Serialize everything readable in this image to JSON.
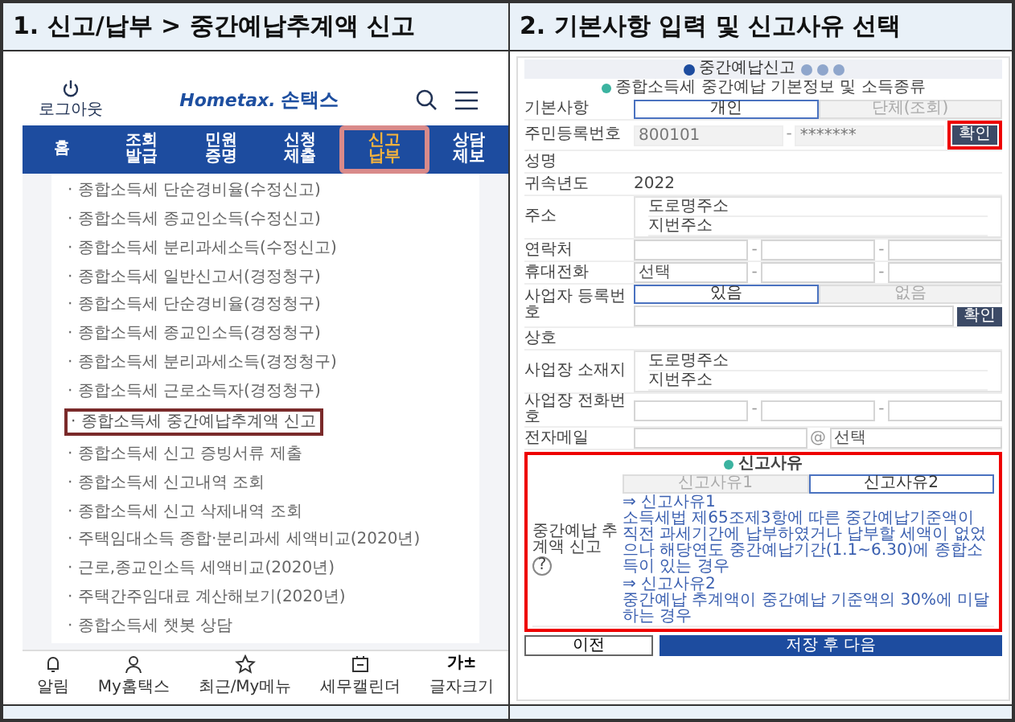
{
  "panels": [
    {
      "title": "1. 신고/납부 > 중간예납추계액 신고"
    },
    {
      "title": "2. 기본사항 입력 및 신고사유 선택"
    }
  ],
  "left_screen": {
    "logout": "로그아웃",
    "logo": "Hometax.",
    "logo_sub": "손택스",
    "nav": [
      {
        "lines": [
          "홈"
        ],
        "selected": false
      },
      {
        "lines": [
          "조회",
          "발급"
        ],
        "selected": false
      },
      {
        "lines": [
          "민원",
          "증명"
        ],
        "selected": false
      },
      {
        "lines": [
          "신청",
          "제출"
        ],
        "selected": false
      },
      {
        "lines": [
          "신고",
          "납부"
        ],
        "selected": true
      },
      {
        "lines": [
          "상담",
          "제보"
        ],
        "selected": false
      }
    ],
    "menu": [
      {
        "label": "· 종합소득세 단순경비율(수정신고)",
        "highlighted": false
      },
      {
        "label": "· 종합소득세 종교인소득(수정신고)",
        "highlighted": false
      },
      {
        "label": "· 종합소득세 분리과세소득(수정신고)",
        "highlighted": false
      },
      {
        "label": "· 종합소득세 일반신고서(경정청구)",
        "highlighted": false
      },
      {
        "label": "· 종합소득세 단순경비율(경정청구)",
        "highlighted": false
      },
      {
        "label": "· 종합소득세 종교인소득(경정청구)",
        "highlighted": false
      },
      {
        "label": "· 종합소득세 분리과세소득(경정청구)",
        "highlighted": false
      },
      {
        "label": "· 종합소득세 근로소득자(경정청구)",
        "highlighted": false
      },
      {
        "label": "· 종합소득세 중간예납추계액 신고",
        "highlighted": true
      },
      {
        "label": "· 종합소득세 신고 증빙서류 제출",
        "highlighted": false
      },
      {
        "label": "· 종합소득세 신고내역 조회",
        "highlighted": false
      },
      {
        "label": "· 종합소득세 신고 삭제내역 조회",
        "highlighted": false
      },
      {
        "label": "· 주택임대소득 종합·분리과세 세액비교(2020년)",
        "highlighted": false
      },
      {
        "label": "· 근로,종교인소득 세액비교(2020년)",
        "highlighted": false
      },
      {
        "label": "· 주택간주임대료 계산해보기(2020년)",
        "highlighted": false
      },
      {
        "label": "· 종합소득세 챗봇 상담",
        "highlighted": false
      }
    ],
    "bottom_nav": [
      {
        "kind": "bell",
        "label": "알림"
      },
      {
        "kind": "person",
        "label": "My홈택스"
      },
      {
        "kind": "star",
        "label": "최근/My메뉴"
      },
      {
        "kind": "calendar",
        "label": "세무캘린더"
      },
      {
        "kind": "text",
        "icon": "가±",
        "label": "글자크기"
      }
    ]
  },
  "right_screen": {
    "progress": {
      "label": "중간예납신고",
      "steps": [
        {
          "selected": true
        },
        {
          "selected": false
        },
        {
          "selected": false
        },
        {
          "selected": false
        }
      ]
    },
    "section_title": "종합소득세 중간예납 기본정보 및 소득종류",
    "rows": [
      {
        "kind": "toggle",
        "label": "기본사항",
        "options": [
          {
            "label": "개인",
            "selected": true
          },
          {
            "label": "단체(조회)",
            "selected": false
          }
        ]
      },
      {
        "kind": "id",
        "label": "주민등록번호",
        "value1": "800101",
        "separator": "-",
        "value2": "*******",
        "button": "확인",
        "highlighted": true
      },
      {
        "kind": "text",
        "label": "성명"
      },
      {
        "kind": "text",
        "label": "귀속년도",
        "value": "2022"
      },
      {
        "kind": "address",
        "label": "주소",
        "lines": [
          "도로명주소",
          "지번주소"
        ]
      },
      {
        "kind": "phone",
        "label": "연락처",
        "separators": [
          "-",
          "-"
        ]
      },
      {
        "kind": "phone",
        "label": "휴대전화",
        "select": "선택",
        "separators": [
          "-",
          "-"
        ]
      },
      {
        "kind": "bizno",
        "label": "사업자 등록번호",
        "options": [
          {
            "label": "있음",
            "selected": true
          },
          {
            "label": "없음",
            "selected": false
          }
        ],
        "button": "확인"
      },
      {
        "kind": "text",
        "label": "상호"
      },
      {
        "kind": "address",
        "label": "사업장 소재지",
        "lines": [
          "도로명주소",
          "지번주소"
        ]
      },
      {
        "kind": "phone",
        "label": "사업장 전화번호",
        "separators": [
          "-",
          "-"
        ]
      },
      {
        "kind": "email",
        "label": "전자메일",
        "at": "@",
        "select": "선택"
      }
    ],
    "reason": {
      "title": "신고사유",
      "label": "중간예납 추계액 신고",
      "help": "?",
      "highlighted": true,
      "options": [
        {
          "label": "신고사유1",
          "selected": false
        },
        {
          "label": "신고사유2",
          "selected": true
        }
      ],
      "notes": [
        {
          "title": "⇒ 신고사유1",
          "text": "소득세법 제65조제3항에 따른 중간예납기준액이 직전 과세기간에 납부하였거나 납부할 세액이 없었으나 해당연도 중간예납기간(1.1~6.30)에 종합소득이 있는 경우"
        },
        {
          "title": "⇒ 신고사유2",
          "text": "중간예납 추계액이 중간예납 기준액의 30%에 미달하는 경우"
        }
      ]
    },
    "buttons": [
      {
        "kind": "secondary",
        "label": "이전"
      },
      {
        "kind": "primary",
        "label": "저장 후 다음"
      }
    ]
  }
}
